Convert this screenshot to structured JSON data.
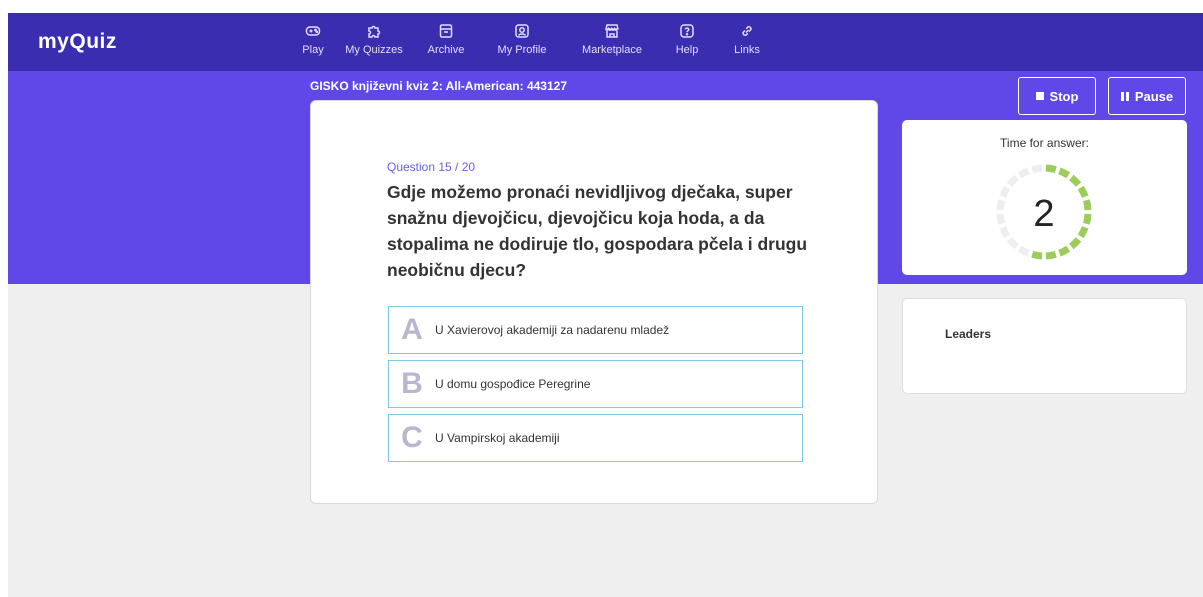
{
  "logo": {
    "text_prefix": "my",
    "text_q": "Q",
    "text_suffix": "uiz"
  },
  "nav": {
    "items": [
      {
        "label": "Play",
        "icon": "gamepad-icon"
      },
      {
        "label": "My Quizzes",
        "icon": "puzzle-icon"
      },
      {
        "label": "Archive",
        "icon": "archive-icon"
      },
      {
        "label": "My Profile",
        "icon": "profile-icon"
      },
      {
        "label": "Marketplace",
        "icon": "store-icon"
      },
      {
        "label": "Help",
        "icon": "help-icon"
      },
      {
        "label": "Links",
        "icon": "link-icon"
      }
    ]
  },
  "quiz": {
    "title": "GISKO književni kviz 2: All-American: 443127"
  },
  "controls": {
    "stop_label": "Stop",
    "pause_label": "Pause"
  },
  "question": {
    "number": "Question 15 / 20",
    "text": "Gdje možemo pronaći nevidljivog dječaka, super snažnu djevojčicu, djevojčicu koja hoda, a da stopalima ne dodiruje tlo, gospodara pčela i drugu neobičnu djecu?",
    "answers": [
      {
        "letter": "A",
        "text": "U Xavierovoj akademiji za nadarenu mladež"
      },
      {
        "letter": "B",
        "text": "U domu gospođice Peregrine"
      },
      {
        "letter": "C",
        "text": "U Vampirskoj akademiji"
      }
    ]
  },
  "timer": {
    "label": "Time for answer:",
    "value": "2",
    "remaining_fraction": 0.55
  },
  "leaders": {
    "title": "Leaders"
  },
  "colors": {
    "nav_bg": "#3b2db0",
    "hero_bg": "#6048e8",
    "accent": "#6a5ee0",
    "timer_active": "#9ccc5a",
    "timer_inactive": "#eeeeee",
    "answer_border": "#7ec8e3"
  }
}
